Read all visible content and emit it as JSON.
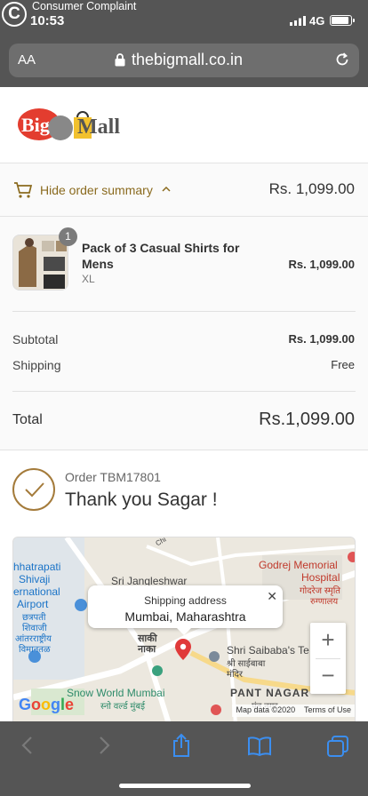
{
  "status_bar": {
    "time": "10:53",
    "network": "4G",
    "watermark_text": "Consumer Complaint"
  },
  "browser": {
    "text_size_label": "AA",
    "url": "thebigmall.co.in"
  },
  "site": {
    "logo_text_big": "Big",
    "logo_text_mall": "Mall"
  },
  "summary_bar": {
    "toggle_label": "Hide order summary",
    "total": "Rs. 1,099.00"
  },
  "product": {
    "quantity": "1",
    "name": "Pack of 3 Casual Shirts for Mens",
    "variant": "XL",
    "price": "Rs. 1,099.00"
  },
  "totals": {
    "subtotal_label": "Subtotal",
    "subtotal_value": "Rs. 1,099.00",
    "shipping_label": "Shipping",
    "shipping_value": "Free",
    "total_label": "Total",
    "total_currency": "Rs.",
    "total_value": "1,099.00"
  },
  "confirmation": {
    "order_number": "Order TBM17801",
    "thank_you": "Thank you Sagar !"
  },
  "map": {
    "tooltip_title": "Shipping address",
    "tooltip_address": "Mumbai, Maharashtra",
    "labels": {
      "chhatrapati": "hhatrapati",
      "shivaji": "Shivaji",
      "international": "ernational",
      "airport": "Airport",
      "chhatrapati_hi": "छत्रपती",
      "shivaji_hi": "शिवाजी",
      "intl_hi": "आंतरराष्ट्रीय",
      "airport_hi": "विमानतळ",
      "jangleshwar": "Sri Jangleshwar",
      "godrej": "Godrej Memorial",
      "hospital": "Hospital",
      "hospital_hi1": "गोदरेज स्मृति",
      "hospital_hi2": "रुग्णालय",
      "saki": "साकी",
      "naka": "नाका",
      "saibaba": "Shri Saibaba's Te",
      "saibaba_hi1": "श्री साईबाबा",
      "saibaba_hi2": "मंदिर",
      "snowworld": "Snow World Mumbai",
      "snowworld_hi": "स्नो वर्ल्ड मुंबई",
      "pantnagar": "PANT NAGAR",
      "pantnagar_hi": "पंत नगर",
      "road": "Chi"
    },
    "google": "Google",
    "attribution_data": "Map data ©2020",
    "attribution_terms": "Terms of Use",
    "zoom_in": "+",
    "zoom_out": "−"
  },
  "colors": {
    "accent_brown": "#8a6a1e",
    "check_ring": "#a47b3b",
    "browser_chrome": "#555555",
    "ios_blue": "#1a73e8"
  }
}
